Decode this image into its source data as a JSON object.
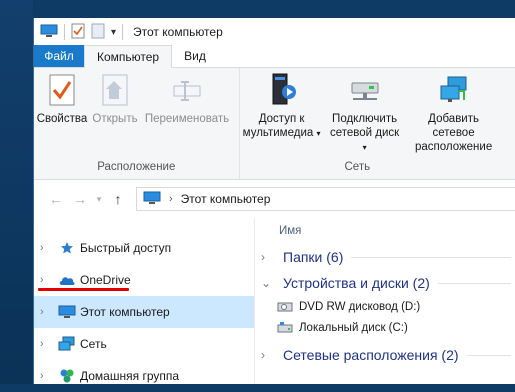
{
  "window": {
    "title": "Этот компьютер"
  },
  "ribbon_tabs": [
    "Файл",
    "Компьютер",
    "Вид"
  ],
  "ribbon": {
    "group_location": {
      "label": "Расположение",
      "buttons": [
        "Свойства",
        "Открыть",
        "Переименовать"
      ]
    },
    "group_network": {
      "label": "Сеть",
      "media_label": [
        "Доступ к",
        "мультимедиа"
      ],
      "map_drive_label": [
        "Подключить",
        "сетевой диск"
      ],
      "add_location_label": [
        "Добавить сетевое",
        "расположение"
      ]
    }
  },
  "address": {
    "path": "Этот компьютер"
  },
  "nav_pane": {
    "items": [
      "Быстрый доступ",
      "OneDrive",
      "Этот компьютер",
      "Сеть",
      "Домашняя группа"
    ]
  },
  "main": {
    "column_header": "Имя",
    "groups": [
      {
        "title": "Папки (6)",
        "expanded": false
      },
      {
        "title": "Устройства и диски (2)",
        "expanded": true
      },
      {
        "title": "Сетевые расположения (2)",
        "expanded": false
      }
    ],
    "drives": [
      "DVD RW дисковод (D:)",
      "Локальный диск (C:)"
    ]
  },
  "icons": {
    "back": "back-arrow-icon",
    "forward": "forward-arrow-icon",
    "recent": "recent-locations-icon",
    "up": "up-arrow-icon"
  },
  "colors": {
    "accent": "#1979ca",
    "selected": "#cce8ff",
    "group_title": "#1e3287",
    "annotation": "#e00000"
  }
}
